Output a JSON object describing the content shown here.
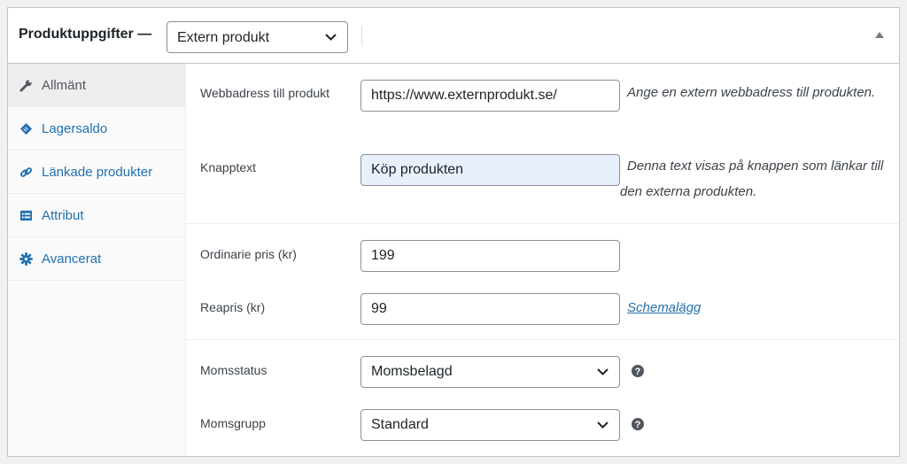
{
  "header": {
    "title": "Produktuppgifter —",
    "product_type": "Extern produkt"
  },
  "sidebar": {
    "items": [
      {
        "label": "Allmänt",
        "icon": "wrench-icon",
        "active": true
      },
      {
        "label": "Lagersaldo",
        "icon": "tag-icon",
        "active": false
      },
      {
        "label": "Länkade produkter",
        "icon": "link-icon",
        "active": false
      },
      {
        "label": "Attribut",
        "icon": "list-icon",
        "active": false
      },
      {
        "label": "Avancerat",
        "icon": "gear-icon",
        "active": false
      }
    ]
  },
  "general": {
    "product_url": {
      "label": "Webbadress till produkt",
      "value": "https://www.externprodukt.se/",
      "description": "Ange en extern webbadress till produkten."
    },
    "button_text": {
      "label": "Knapptext",
      "value": "Köp produkten",
      "description": "Denna text visas på knappen som länkar till den externa produkten."
    },
    "regular_price": {
      "label": "Ordinarie pris (kr)",
      "value": "199"
    },
    "sale_price": {
      "label": "Reapris (kr)",
      "value": "99",
      "schedule_link": "Schemalägg"
    },
    "tax_status": {
      "label": "Momsstatus",
      "value": "Momsbelagd"
    },
    "tax_class": {
      "label": "Momsgrupp",
      "value": "Standard"
    }
  },
  "colors": {
    "link": "#2271b1",
    "highlight_input": "#e8f0fe",
    "active_tab": "#eeeeee"
  }
}
